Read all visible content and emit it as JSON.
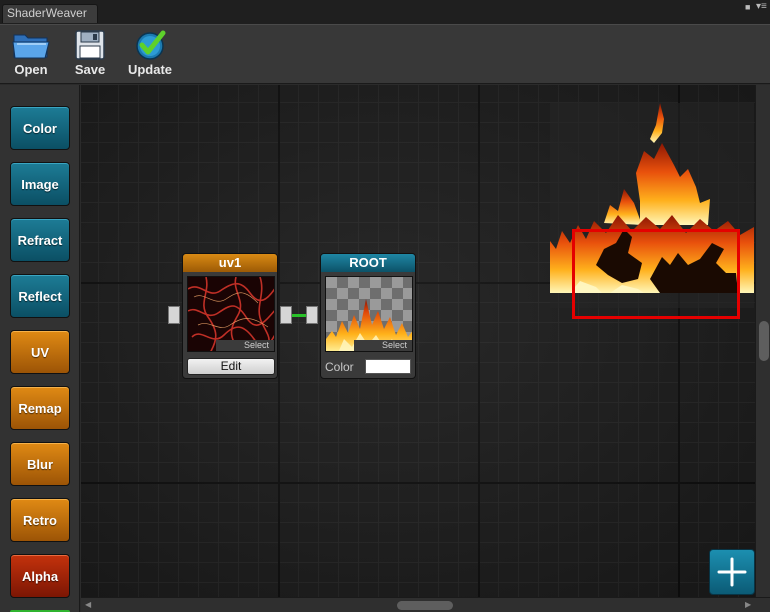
{
  "window": {
    "tab_title": "ShaderWeaver"
  },
  "toolbar": {
    "open_label": "Open",
    "save_label": "Save",
    "update_label": "Update"
  },
  "palette": {
    "items": [
      {
        "label": "Color",
        "style": "blue"
      },
      {
        "label": "Image",
        "style": "blue"
      },
      {
        "label": "Refract",
        "style": "blue"
      },
      {
        "label": "Reflect",
        "style": "blue"
      },
      {
        "label": "UV",
        "style": "orange"
      },
      {
        "label": "Remap",
        "style": "orange"
      },
      {
        "label": "Blur",
        "style": "orange"
      },
      {
        "label": "Retro",
        "style": "orange"
      },
      {
        "label": "Alpha",
        "style": "red"
      }
    ]
  },
  "nodes": {
    "uv1": {
      "title": "uv1",
      "select_label": "Select",
      "edit_label": "Edit"
    },
    "root": {
      "title": "ROOT",
      "select_label": "Select",
      "color_label": "Color",
      "color_value": "#ffffff"
    }
  },
  "colors": {
    "accent_blue": "#0c5268",
    "accent_orange": "#d98a14",
    "wire_green": "#29c229",
    "selection_red": "#e50000"
  },
  "icons": {
    "open": "folder-icon",
    "save": "floppy-disk-icon",
    "update": "checkmark-icon",
    "add": "plus-icon"
  }
}
